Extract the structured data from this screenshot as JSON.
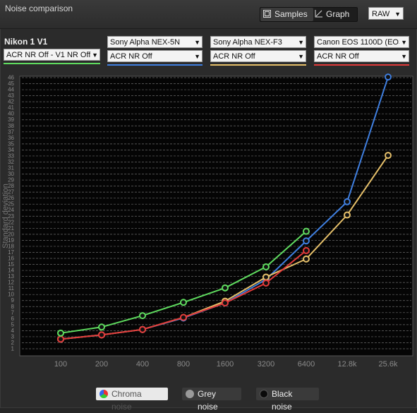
{
  "window": {
    "title": "Noise comparison"
  },
  "view_toggle": {
    "samples_label": "Samples",
    "graph_label": "Graph"
  },
  "format_select": {
    "value": "RAW"
  },
  "cameras": [
    {
      "name": "Nikon 1 V1",
      "setting": "ACR NR Off - V1 NR Off",
      "color": "#5fdc5f"
    },
    {
      "name": "Sony Alpha NEX-5N",
      "setting": "ACR NR Off",
      "color": "#3f7fe0"
    },
    {
      "name": "Sony Alpha NEX-F3",
      "setting": "ACR NR Off",
      "color": "#e6c06a"
    },
    {
      "name": "Canon EOS 1100D (EOS",
      "setting": "ACR NR Off",
      "color": "#e23a3a"
    }
  ],
  "legend": {
    "chroma": "Chroma noise",
    "grey": "Grey noise",
    "black": "Black noise"
  },
  "chart_data": {
    "type": "line",
    "ylabel": "Standard deviation",
    "xlabel": "",
    "categories": [
      "100",
      "200",
      "400",
      "800",
      "1600",
      "3200",
      "6400",
      "12.8k",
      "25.6k"
    ],
    "ylim": [
      1,
      46
    ],
    "y_ticks": [
      1,
      2,
      3,
      4,
      5,
      6,
      7,
      8,
      9,
      10,
      11,
      12,
      13,
      14,
      15,
      16,
      17,
      18,
      19,
      20,
      21,
      22,
      23,
      24,
      25,
      26,
      27,
      28,
      29,
      30,
      31,
      32,
      33,
      34,
      35,
      36,
      37,
      38,
      39,
      40,
      41,
      42,
      43,
      44,
      45,
      46
    ],
    "grid": true,
    "series": [
      {
        "name": "Nikon 1 V1",
        "color": "#5fdc5f",
        "values": [
          3.6,
          4.6,
          6.5,
          8.7,
          11.1,
          14.6,
          20.5,
          null,
          null
        ]
      },
      {
        "name": "Sony Alpha NEX-5N",
        "color": "#3f7fe0",
        "values": [
          2.6,
          3.3,
          4.2,
          6.1,
          8.6,
          12.5,
          18.9,
          25.4,
          46.1
        ]
      },
      {
        "name": "Sony Alpha NEX-F3",
        "color": "#e6c06a",
        "values": [
          2.6,
          3.3,
          4.2,
          6.2,
          8.9,
          12.9,
          15.9,
          23.2,
          33.1
        ]
      },
      {
        "name": "Canon EOS 1100D",
        "color": "#e23a3a",
        "values": [
          2.6,
          3.3,
          4.2,
          6.2,
          8.6,
          11.9,
          17.3,
          null,
          null
        ]
      }
    ]
  }
}
